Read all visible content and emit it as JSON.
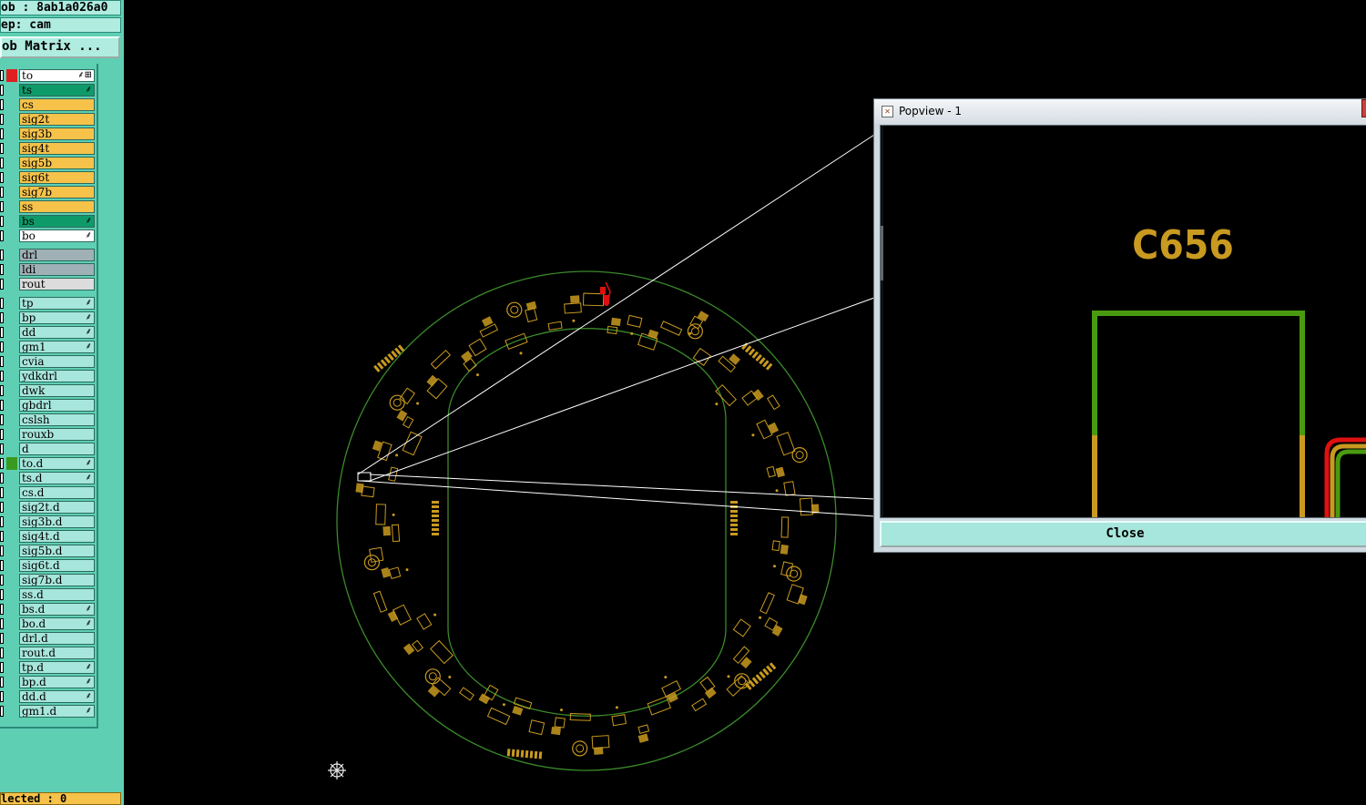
{
  "sidebar": {
    "job_label": "ob : 8ab1a026a0",
    "step_label": "ep: cam",
    "job_matrix_button": "ob Matrix ...",
    "selected_label": "lected : 0",
    "layers": [
      {
        "name": "to",
        "bg": "#ffffff",
        "mark": "#e02020",
        "flag": "⸙⊞"
      },
      {
        "name": "ts",
        "bg": "#0f9a6a",
        "mark": "",
        "flag": "⸙"
      },
      {
        "name": "cs",
        "bg": "#f6c24a",
        "mark": "",
        "flag": ""
      },
      {
        "name": "sig2t",
        "bg": "#f6c24a",
        "mark": "",
        "flag": ""
      },
      {
        "name": "sig3b",
        "bg": "#f6c24a",
        "mark": "",
        "flag": ""
      },
      {
        "name": "sig4t",
        "bg": "#f6c24a",
        "mark": "",
        "flag": ""
      },
      {
        "name": "sig5b",
        "bg": "#f6c24a",
        "mark": "",
        "flag": ""
      },
      {
        "name": "sig6t",
        "bg": "#f6c24a",
        "mark": "",
        "flag": ""
      },
      {
        "name": "sig7b",
        "bg": "#f6c24a",
        "mark": "",
        "flag": ""
      },
      {
        "name": "ss",
        "bg": "#f6c24a",
        "mark": "",
        "flag": ""
      },
      {
        "name": "bs",
        "bg": "#0f9a6a",
        "mark": "",
        "flag": "⸙"
      },
      {
        "name": "bo",
        "bg": "#ffffff",
        "mark": "",
        "flag": "⸙"
      },
      {
        "name": "drl",
        "bg": "#9fb0b6",
        "mark": "",
        "flag": ""
      },
      {
        "name": "ldi",
        "bg": "#9fb0b6",
        "mark": "",
        "flag": ""
      },
      {
        "name": "rout",
        "bg": "#dcdcdc",
        "mark": "",
        "flag": ""
      },
      {
        "name": "tp",
        "bg": "#a7e6dc",
        "mark": "",
        "flag": "⸙"
      },
      {
        "name": "bp",
        "bg": "#a7e6dc",
        "mark": "",
        "flag": "⸙"
      },
      {
        "name": "dd",
        "bg": "#a7e6dc",
        "mark": "",
        "flag": "⸙"
      },
      {
        "name": "gm1",
        "bg": "#a7e6dc",
        "mark": "",
        "flag": "⸙"
      },
      {
        "name": "cvia",
        "bg": "#a7e6dc",
        "mark": "",
        "flag": ""
      },
      {
        "name": "ydkdrl",
        "bg": "#a7e6dc",
        "mark": "",
        "flag": ""
      },
      {
        "name": "dwk",
        "bg": "#a7e6dc",
        "mark": "",
        "flag": ""
      },
      {
        "name": "gbdrl",
        "bg": "#a7e6dc",
        "mark": "",
        "flag": ""
      },
      {
        "name": "cslsh",
        "bg": "#a7e6dc",
        "mark": "",
        "flag": ""
      },
      {
        "name": "rouxb",
        "bg": "#a7e6dc",
        "mark": "",
        "flag": ""
      },
      {
        "name": "d",
        "bg": "#a7e6dc",
        "mark": "",
        "flag": ""
      },
      {
        "name": "to.d",
        "bg": "#a7e6dc",
        "mark": "#3a9a20",
        "flag": "⸙"
      },
      {
        "name": "ts.d",
        "bg": "#a7e6dc",
        "mark": "",
        "flag": "⸙"
      },
      {
        "name": "cs.d",
        "bg": "#a7e6dc",
        "mark": "",
        "flag": ""
      },
      {
        "name": "sig2t.d",
        "bg": "#a7e6dc",
        "mark": "",
        "flag": ""
      },
      {
        "name": "sig3b.d",
        "bg": "#a7e6dc",
        "mark": "",
        "flag": ""
      },
      {
        "name": "sig4t.d",
        "bg": "#a7e6dc",
        "mark": "",
        "flag": ""
      },
      {
        "name": "sig5b.d",
        "bg": "#a7e6dc",
        "mark": "",
        "flag": ""
      },
      {
        "name": "sig6t.d",
        "bg": "#a7e6dc",
        "mark": "",
        "flag": ""
      },
      {
        "name": "sig7b.d",
        "bg": "#a7e6dc",
        "mark": "",
        "flag": ""
      },
      {
        "name": "ss.d",
        "bg": "#a7e6dc",
        "mark": "",
        "flag": ""
      },
      {
        "name": "bs.d",
        "bg": "#a7e6dc",
        "mark": "",
        "flag": "⸙"
      },
      {
        "name": "bo.d",
        "bg": "#a7e6dc",
        "mark": "",
        "flag": "⸙"
      },
      {
        "name": "drl.d",
        "bg": "#a7e6dc",
        "mark": "",
        "flag": ""
      },
      {
        "name": "rout.d",
        "bg": "#a7e6dc",
        "mark": "",
        "flag": ""
      },
      {
        "name": "tp.d",
        "bg": "#a7e6dc",
        "mark": "",
        "flag": "⸙"
      },
      {
        "name": "bp.d",
        "bg": "#a7e6dc",
        "mark": "",
        "flag": "⸙"
      },
      {
        "name": "dd.d",
        "bg": "#a7e6dc",
        "mark": "",
        "flag": "⸙"
      },
      {
        "name": "gm1.d",
        "bg": "#a7e6dc",
        "mark": "",
        "flag": "⸙"
      }
    ]
  },
  "popview": {
    "title": "Popview - 1",
    "close_button": "Close",
    "component_label": "C656"
  },
  "colors": {
    "board_outline": "#3a8a2a",
    "component": "#c99a20",
    "selection": "#e01010",
    "popview_rect": "#4a9a10",
    "highlight": "#ffffff"
  },
  "icons": {
    "cursor": "crosshair-wheel-icon",
    "window": "popview-window-icon"
  }
}
